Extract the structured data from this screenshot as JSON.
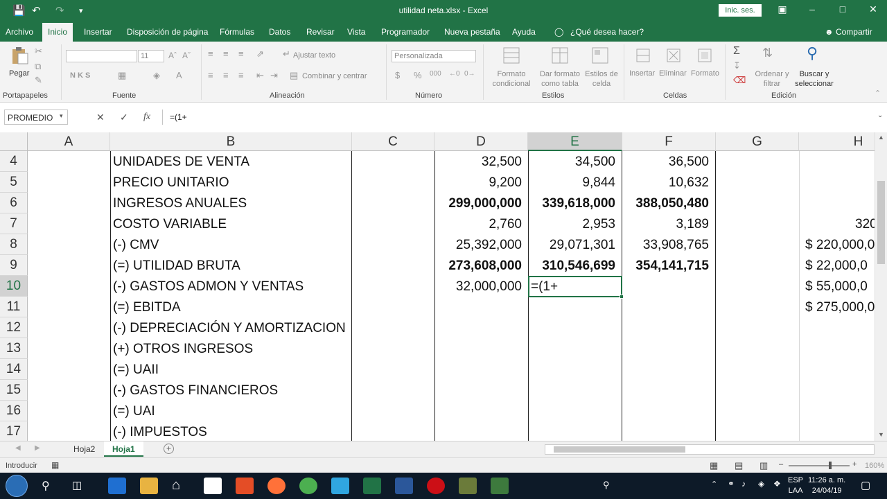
{
  "window": {
    "title": "utilidad neta.xlsx  -  Excel",
    "signin_label": "Inic. ses."
  },
  "colors": {
    "excel_green": "#217346",
    "taskbar": "#0d1a28"
  },
  "tabs": [
    {
      "label": "Archivo"
    },
    {
      "label": "Inicio"
    },
    {
      "label": "Insertar"
    },
    {
      "label": "Disposición de página"
    },
    {
      "label": "Fórmulas"
    },
    {
      "label": "Datos"
    },
    {
      "label": "Revisar"
    },
    {
      "label": "Vista"
    },
    {
      "label": "Programador"
    },
    {
      "label": "Nueva pestaña"
    },
    {
      "label": "Ayuda"
    },
    {
      "label": "¿Qué desea hacer?"
    }
  ],
  "share_label": "Compartir",
  "ribbon": {
    "groups": [
      "Portapapeles",
      "Fuente",
      "Alineación",
      "Número",
      "Estilos",
      "Celdas",
      "Edición"
    ],
    "paste_label": "Pegar",
    "font_size": "11",
    "bold_italic_under": "N   K   S",
    "wrap_text": "Ajustar texto",
    "merge_center": "Combinar y centrar",
    "number_format": "Personalizada",
    "cond_format": "Formato condicional",
    "format_table": "Dar formato como tabla",
    "cell_styles": "Estilos de celda",
    "insert": "Insertar",
    "delete": "Eliminar",
    "format": "Formato",
    "sort_filter": "Ordenar y filtrar",
    "find_select": "Buscar y seleccionar"
  },
  "formula_bar": {
    "name_box": "PROMEDIO",
    "fx": "fx",
    "formula": "=(1+"
  },
  "columns": [
    "A",
    "B",
    "C",
    "D",
    "E",
    "F",
    "G",
    "H"
  ],
  "rows": [
    {
      "n": "4",
      "b": "UNIDADES DE VENTA",
      "d": "32,500",
      "e": "34,500",
      "f": "36,500",
      "h": "",
      "bold": false
    },
    {
      "n": "5",
      "b": "PRECIO  UNITARIO",
      "d": "9,200",
      "e": "9,844",
      "f": "10,632",
      "h": "",
      "bold": false
    },
    {
      "n": "6",
      "b": "INGRESOS ANUALES",
      "d": "299,000,000",
      "e": "339,618,000",
      "f": "388,050,480",
      "h": "",
      "bold": true
    },
    {
      "n": "7",
      "b": "COSTO VARIABLE",
      "d": "2,760",
      "e": "2,953",
      "f": "3,189",
      "h": "320",
      "bold": false
    },
    {
      "n": "8",
      "b": "(-) CMV",
      "d": "25,392,000",
      "e": "29,071,301",
      "f": "33,908,765",
      "h": "$ 220,000,0",
      "bold": false
    },
    {
      "n": "9",
      "b": "(=) UTILIDAD BRUTA",
      "d": "273,608,000",
      "e": "310,546,699",
      "f": "354,141,715",
      "h": "$   22,000,0",
      "bold": true
    },
    {
      "n": "10",
      "b": "(-) GASTOS ADMON Y VENTAS",
      "d": "32,000,000",
      "e": "=(1+",
      "f": "",
      "h": "$   55,000,0",
      "bold": false
    },
    {
      "n": "11",
      "b": "(=) EBITDA",
      "d": "",
      "e": "",
      "f": "",
      "h": "$ 275,000,0",
      "bold": false
    },
    {
      "n": "12",
      "b": "(-) DEPRECIACIÓN Y AMORTIZACION",
      "d": "",
      "e": "",
      "f": "",
      "h": "",
      "bold": false
    },
    {
      "n": "13",
      "b": "(+) OTROS INGRESOS",
      "d": "",
      "e": "",
      "f": "",
      "h": "",
      "bold": false
    },
    {
      "n": "14",
      "b": "(=) UAII",
      "d": "",
      "e": "",
      "f": "",
      "h": "",
      "bold": false
    },
    {
      "n": "15",
      "b": "(-) GASTOS FINANCIEROS",
      "d": "",
      "e": "",
      "f": "",
      "h": "",
      "bold": false
    },
    {
      "n": "16",
      "b": "(=) UAI",
      "d": "",
      "e": "",
      "f": "",
      "h": "",
      "bold": false
    },
    {
      "n": "17",
      "b": "(-) IMPUESTOS",
      "d": "",
      "e": "",
      "f": "",
      "h": "",
      "bold": false
    }
  ],
  "sheets": [
    {
      "label": "Hoja2",
      "active": false
    },
    {
      "label": "Hoja1",
      "active": true
    }
  ],
  "status": {
    "mode": "Introducir",
    "zoom": "160%"
  },
  "taskbar": {
    "lang_1": "ESP",
    "lang_2": "LAA",
    "time": "11:26 a. m.",
    "date": "24/04/19"
  }
}
